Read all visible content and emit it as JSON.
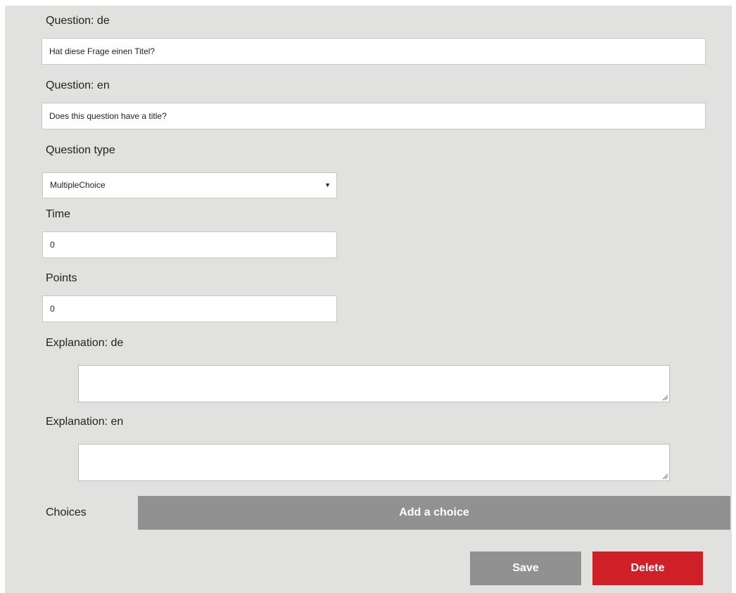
{
  "form": {
    "question_de": {
      "label": "Question: de",
      "value": "Hat diese Frage einen Titel?"
    },
    "question_en": {
      "label": "Question: en",
      "value": "Does this question have a title?"
    },
    "question_type": {
      "label": "Question type",
      "value": "MultipleChoice"
    },
    "time": {
      "label": "Time",
      "value": "0"
    },
    "points": {
      "label": "Points",
      "value": "0"
    },
    "explanation_de": {
      "label": "Explanation: de",
      "value": ""
    },
    "explanation_en": {
      "label": "Explanation: en",
      "value": ""
    },
    "choices": {
      "label": "Choices",
      "add_label": "Add a choice"
    }
  },
  "actions": {
    "save_label": "Save",
    "delete_label": "Delete"
  },
  "colors": {
    "panel_bg": "#e1e1e0",
    "button_gray": "#919191",
    "button_red": "#cf1f27"
  },
  "icons": {
    "select_arrow": "triangle-down-icon",
    "textarea_resize": "resize-grip-icon"
  }
}
